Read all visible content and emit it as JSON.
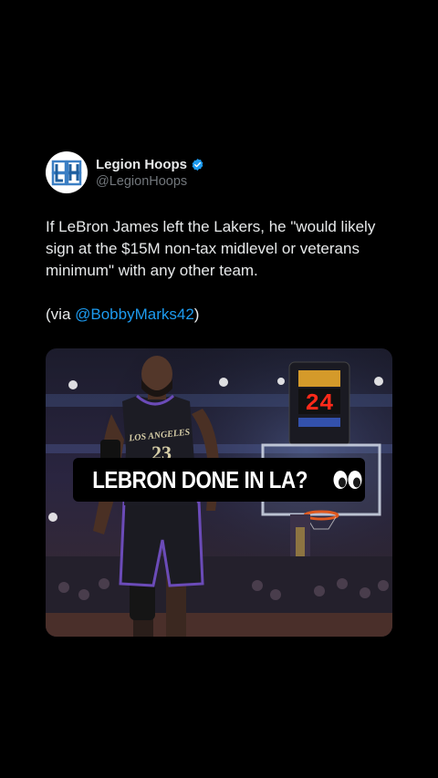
{
  "tweet": {
    "display_name": "Legion Hoops",
    "handle": "@LegionHoops",
    "avatar_icon": "legion-hoops-logo-icon",
    "verified_icon": "verified-badge-icon",
    "text": "If LeBron James left the Lakers, he \"would likely sign at the $15M non-tax midlevel or veterans minimum\" with any other team.",
    "via_prefix": "(via ",
    "via_mention": "@BobbyMarks42",
    "via_suffix": ")"
  },
  "media": {
    "caption": "LEBRON DONE IN LA?",
    "caption_icon": "eyes-emoji-icon",
    "shot_clock": "24",
    "jersey_text": "LOS ANGELES",
    "jersey_number": "23"
  },
  "colors": {
    "background": "#000000",
    "text": "#e7e9ea",
    "secondary_text": "#71767b",
    "link": "#1d9bf0",
    "verified": "#1d9bf0"
  }
}
